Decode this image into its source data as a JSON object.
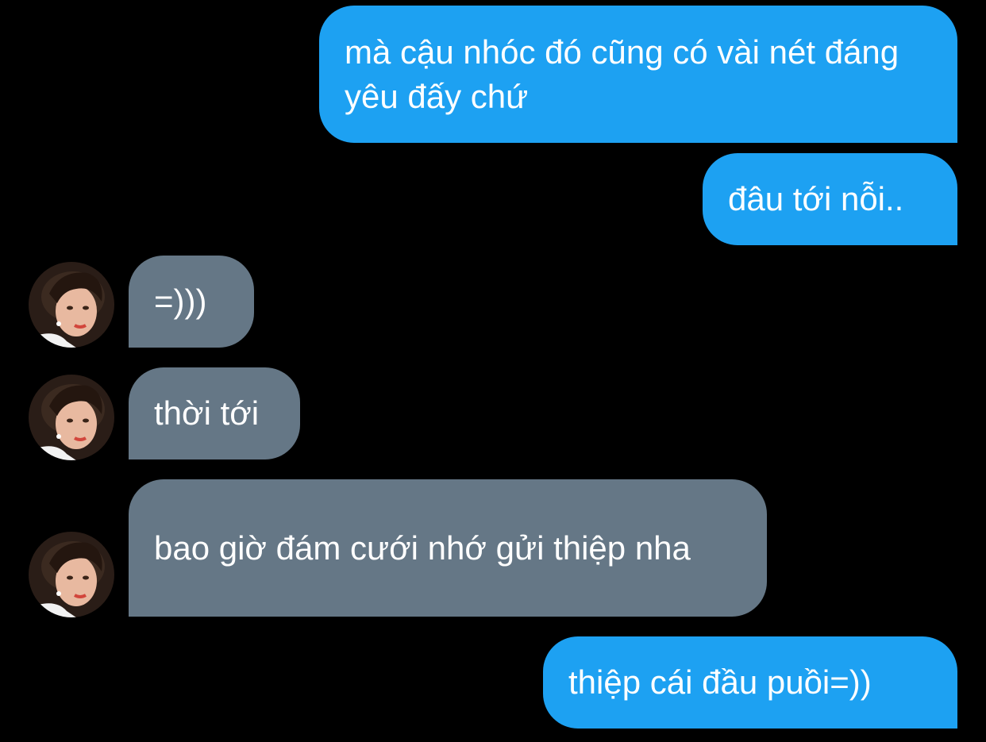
{
  "conversation": {
    "messages": [
      {
        "sender": "me",
        "text": "mà cậu nhóc đó cũng có vài nét đáng yêu đấy chứ"
      },
      {
        "sender": "me",
        "text": "đâu tới nỗi.."
      },
      {
        "sender": "them",
        "text": "=)))"
      },
      {
        "sender": "them",
        "text": "thời tới"
      },
      {
        "sender": "them",
        "text": "bao giờ đám cưới nhớ gửi thiệp nha"
      },
      {
        "sender": "me",
        "text": "thiệp cái đầu puồi=))"
      }
    ]
  },
  "theme": {
    "background": "#000000",
    "sent_bubble": "#1da1f2",
    "received_bubble": "#657786",
    "text": "#ffffff"
  },
  "icons": {
    "avatar": "profile-photo-avatar-icon"
  }
}
